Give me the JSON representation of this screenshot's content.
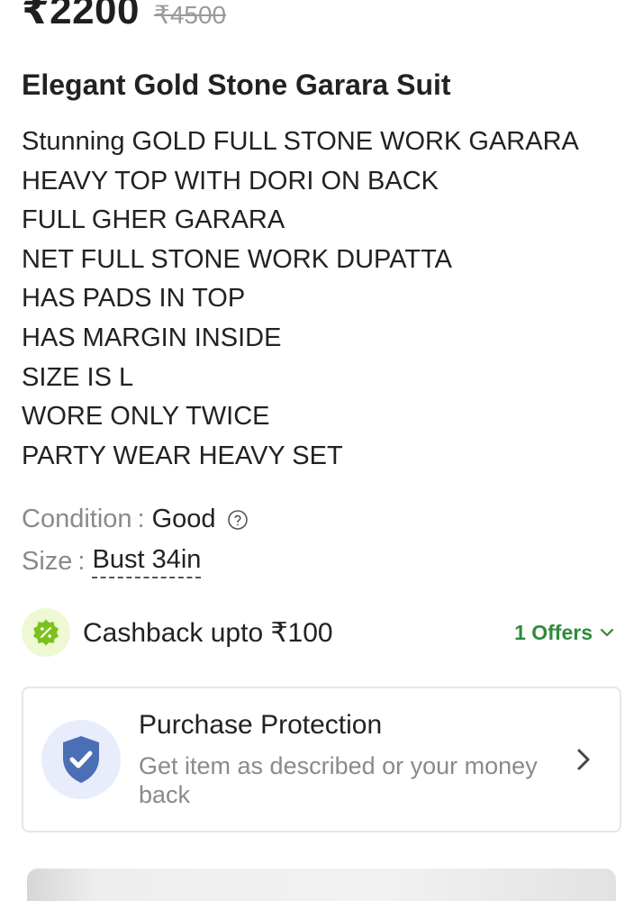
{
  "price": {
    "current": "₹2200",
    "mrp": "₹4500"
  },
  "product": {
    "title": "Elegant Gold Stone Garara Suit",
    "description_lines": [
      "Stunning GOLD FULL STONE WORK GARARA",
      "HEAVY TOP WITH DORI ON BACK",
      "FULL GHER GARARA",
      "NET FULL STONE WORK DUPATTA",
      "HAS PADS IN TOP",
      "HAS MARGIN INSIDE",
      "SIZE IS L",
      "WORE ONLY TWICE",
      "PARTY WEAR HEAVY SET"
    ]
  },
  "attributes": {
    "condition_label": "Condition",
    "condition_value": "Good",
    "size_label": "Size",
    "size_value": "Bust 34in",
    "separator": ":"
  },
  "cashback": {
    "text": "Cashback upto ₹100",
    "offers_label": "1 Offers",
    "icon": "percent-badge-icon"
  },
  "protection": {
    "title": "Purchase Protection",
    "subtitle": "Get item as described or your money back",
    "icon": "shield-check-icon"
  },
  "colors": {
    "offers_green": "#2e8b3a",
    "cashback_badge": "#7cc21f",
    "shield_blue": "#4a6fb5",
    "muted_text": "#8a8a8a"
  }
}
